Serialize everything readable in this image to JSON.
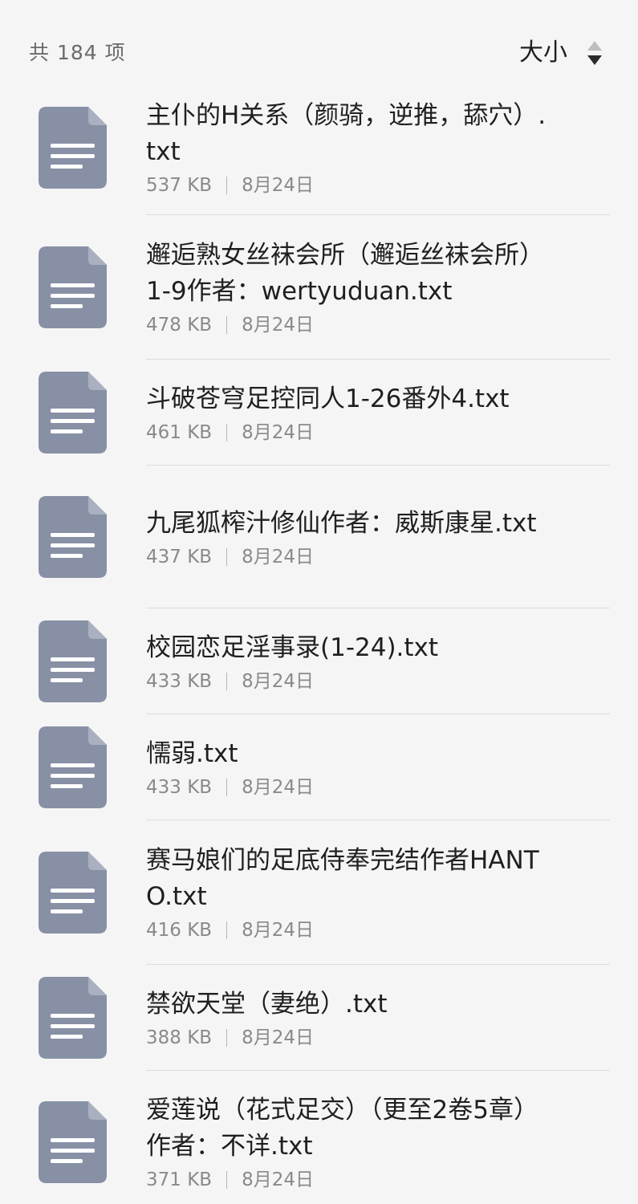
{
  "header": {
    "count_label": "共 184 项",
    "sort_label": "大小",
    "sort_icon": "sort-desc-icon"
  },
  "colors": {
    "background": "#f5f5f5",
    "file_icon": "#8790a5",
    "divider": "#dcdcdc"
  },
  "files": [
    {
      "name": "主仆的H关系（颜骑，逆推，舔穴）.txt",
      "size": "537 KB",
      "date": "8月24日"
    },
    {
      "name": "邂逅熟女丝袜会所（邂逅丝袜会所）1-9作者：wertyuduan.txt",
      "size": "478 KB",
      "date": "8月24日"
    },
    {
      "name": "斗破苍穹足控同人1-26番外4.txt",
      "size": "461 KB",
      "date": "8月24日"
    },
    {
      "name": "九尾狐榨汁修仙作者：威斯康星.txt",
      "size": "437 KB",
      "date": "8月24日"
    },
    {
      "name": "校园恋足淫事录(1-24).txt",
      "size": "433 KB",
      "date": "8月24日"
    },
    {
      "name": "懦弱.txt",
      "size": "433 KB",
      "date": "8月24日"
    },
    {
      "name": "赛马娘们的足底侍奉完结作者HANTO.txt",
      "size": "416 KB",
      "date": "8月24日"
    },
    {
      "name": "禁欲天堂（妻绝）.txt",
      "size": "388 KB",
      "date": "8月24日"
    },
    {
      "name": "爱莲说（花式足交）（更至2卷5章）作者：不详.txt",
      "size": "371 KB",
      "date": "8月24日"
    }
  ]
}
